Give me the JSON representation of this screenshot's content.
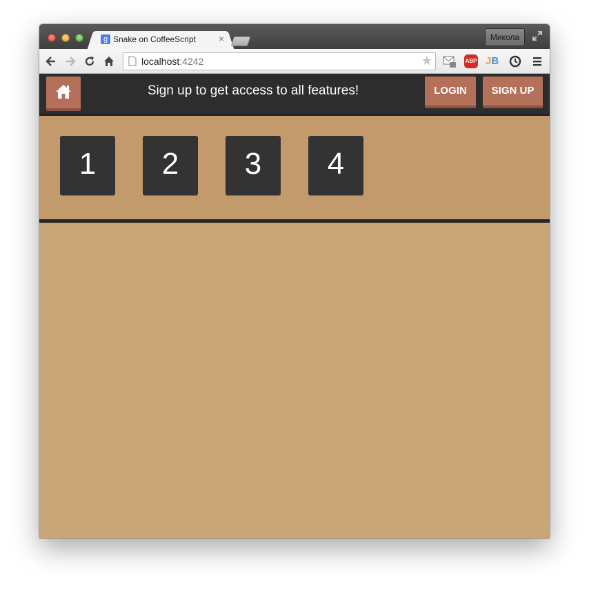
{
  "browser": {
    "tab_title": "Snake on CoffeeScript",
    "tab_favicon": "g",
    "tab_close": "×",
    "profile_name": "Микола",
    "url_host": "localhost",
    "url_port": ":4242",
    "bookmark_star": "★"
  },
  "header": {
    "banner": "Sign up to get access to all features!",
    "login_label": "LOGIN",
    "signup_label": "SIGN UP"
  },
  "levels": [
    "1",
    "2",
    "3",
    "4"
  ],
  "colors": {
    "accent": "#b5705a",
    "header_bg": "#2d2d2d",
    "levels_bg": "#c29a6b",
    "page_bg": "#c8a678",
    "tile_bg": "#333333"
  }
}
